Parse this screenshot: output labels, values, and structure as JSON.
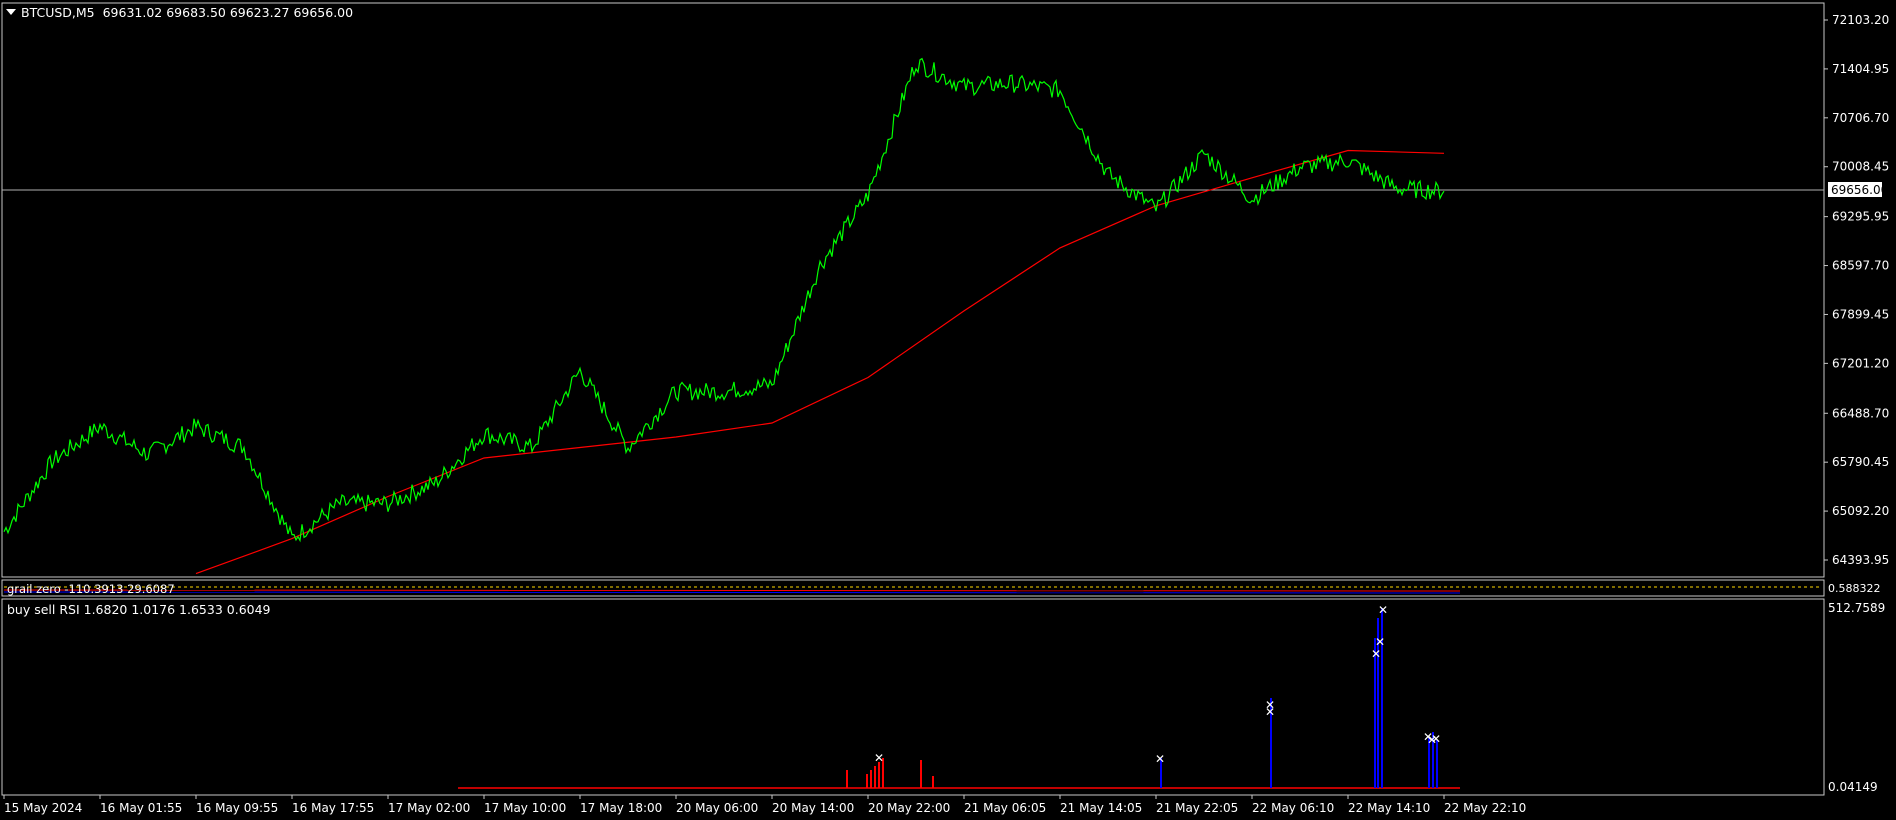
{
  "colors": {
    "background": "#000000",
    "frame": "#c8c8c8",
    "price_line": "#00ff00",
    "moving_average": "#ff0000",
    "bid_line": "#b0b0b0",
    "rsi_buy": "#0000ff",
    "rsi_sell": "#ff0000",
    "zero_level": "#ffd700"
  },
  "symbol_header": {
    "menu_icon": "triangle-down-icon",
    "title": "BTCUSD,M5",
    "ohlc": "69631.02 69683.50 69623.27 69656.00"
  },
  "price_scale": {
    "ticks": [
      "72103.20",
      "71404.95",
      "70706.70",
      "70008.45",
      "69295.95",
      "68597.70",
      "67899.45",
      "67201.20",
      "66488.70",
      "65790.45",
      "65092.20",
      "64393.95"
    ],
    "current_price": "69656.00"
  },
  "indicator_grail": {
    "label": "grail zero -110.3913 29.6087",
    "scale_label": "0.588322"
  },
  "indicator_rsi": {
    "label": "buy sell RSI 1.6820 1.0176 1.6533 0.6049",
    "scale_top": "512.7589",
    "scale_bottom": "0.04149"
  },
  "time_axis": {
    "labels": [
      "15 May 2024",
      "16 May 01:55",
      "16 May 09:55",
      "16 May 17:55",
      "17 May 02:00",
      "17 May 10:00",
      "17 May 18:00",
      "20 May 06:00",
      "20 May 14:00",
      "20 May 22:00",
      "21 May 06:05",
      "21 May 14:05",
      "21 May 22:05",
      "22 May 06:10",
      "22 May 14:10",
      "22 May 22:10"
    ]
  },
  "chart_data": {
    "type": "line",
    "symbol": "BTCUSD",
    "timeframe": "M5",
    "ylim": [
      64200,
      72300
    ],
    "last_price": 69656.0,
    "series": [
      {
        "name": "BTCUSD",
        "x": [
          "15 May 2024",
          "15 May 23:00",
          "16 May 01:55",
          "16 May 05:00",
          "16 May 09:55",
          "16 May 13:00",
          "16 May 17:55",
          "16 May 22:00",
          "17 May 02:00",
          "17 May 06:00",
          "17 May 10:00",
          "17 May 14:00",
          "17 May 18:00",
          "20 May 01:00",
          "20 May 06:00",
          "20 May 10:00",
          "20 May 14:00",
          "20 May 18:00",
          "20 May 22:00",
          "21 May 02:00",
          "21 May 06:05",
          "21 May 10:00",
          "21 May 14:05",
          "21 May 18:00",
          "21 May 22:05",
          "22 May 02:00",
          "22 May 06:10",
          "22 May 10:00",
          "22 May 14:10",
          "22 May 18:00",
          "22 May 22:10"
        ],
        "values": [
          64800,
          65800,
          66300,
          65900,
          66300,
          66000,
          64700,
          65200,
          65200,
          65500,
          66200,
          66000,
          67100,
          66000,
          66800,
          66800,
          66900,
          68600,
          69600,
          71500,
          71150,
          71200,
          71100,
          69900,
          69400,
          70200,
          69550,
          70000,
          70100,
          69700,
          69660
        ]
      },
      {
        "name": "MA",
        "x": [
          "16 May 09:55",
          "16 May 17:55",
          "17 May 02:00",
          "17 May 10:00",
          "17 May 18:00",
          "20 May 06:00",
          "20 May 14:00",
          "20 May 22:00",
          "21 May 06:05",
          "21 May 14:05",
          "21 May 22:05",
          "22 May 06:10",
          "22 May 14:10",
          "22 May 22:10"
        ],
        "values": [
          64200,
          64700,
          65300,
          65850,
          66000,
          66150,
          66350,
          67000,
          67950,
          68850,
          69450,
          69850,
          70240,
          70200
        ]
      }
    ]
  }
}
